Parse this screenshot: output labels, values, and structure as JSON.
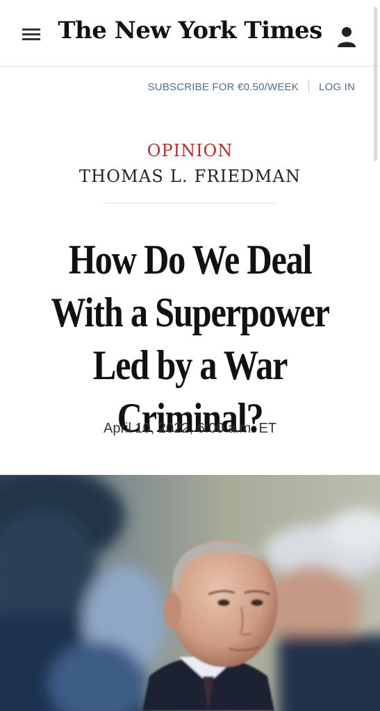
{
  "header": {
    "logo": "The New York Times",
    "menu_icon": "hamburger-menu-icon",
    "account_icon": "user-account-icon"
  },
  "subscribe_bar": {
    "subscribe_label": "SUBSCRIBE FOR €0.50/WEEK",
    "login_label": "LOG IN"
  },
  "article": {
    "kicker": "OPINION",
    "byline": "THOMAS L. FRIEDMAN",
    "headline": "How Do We Deal With a Superpower Led by a War Criminal?",
    "date": "April 10, 2022, 6:00 a.m. ET"
  },
  "colors": {
    "kicker": "#c0282a",
    "link": "#4d6e94",
    "text": "#111111"
  }
}
